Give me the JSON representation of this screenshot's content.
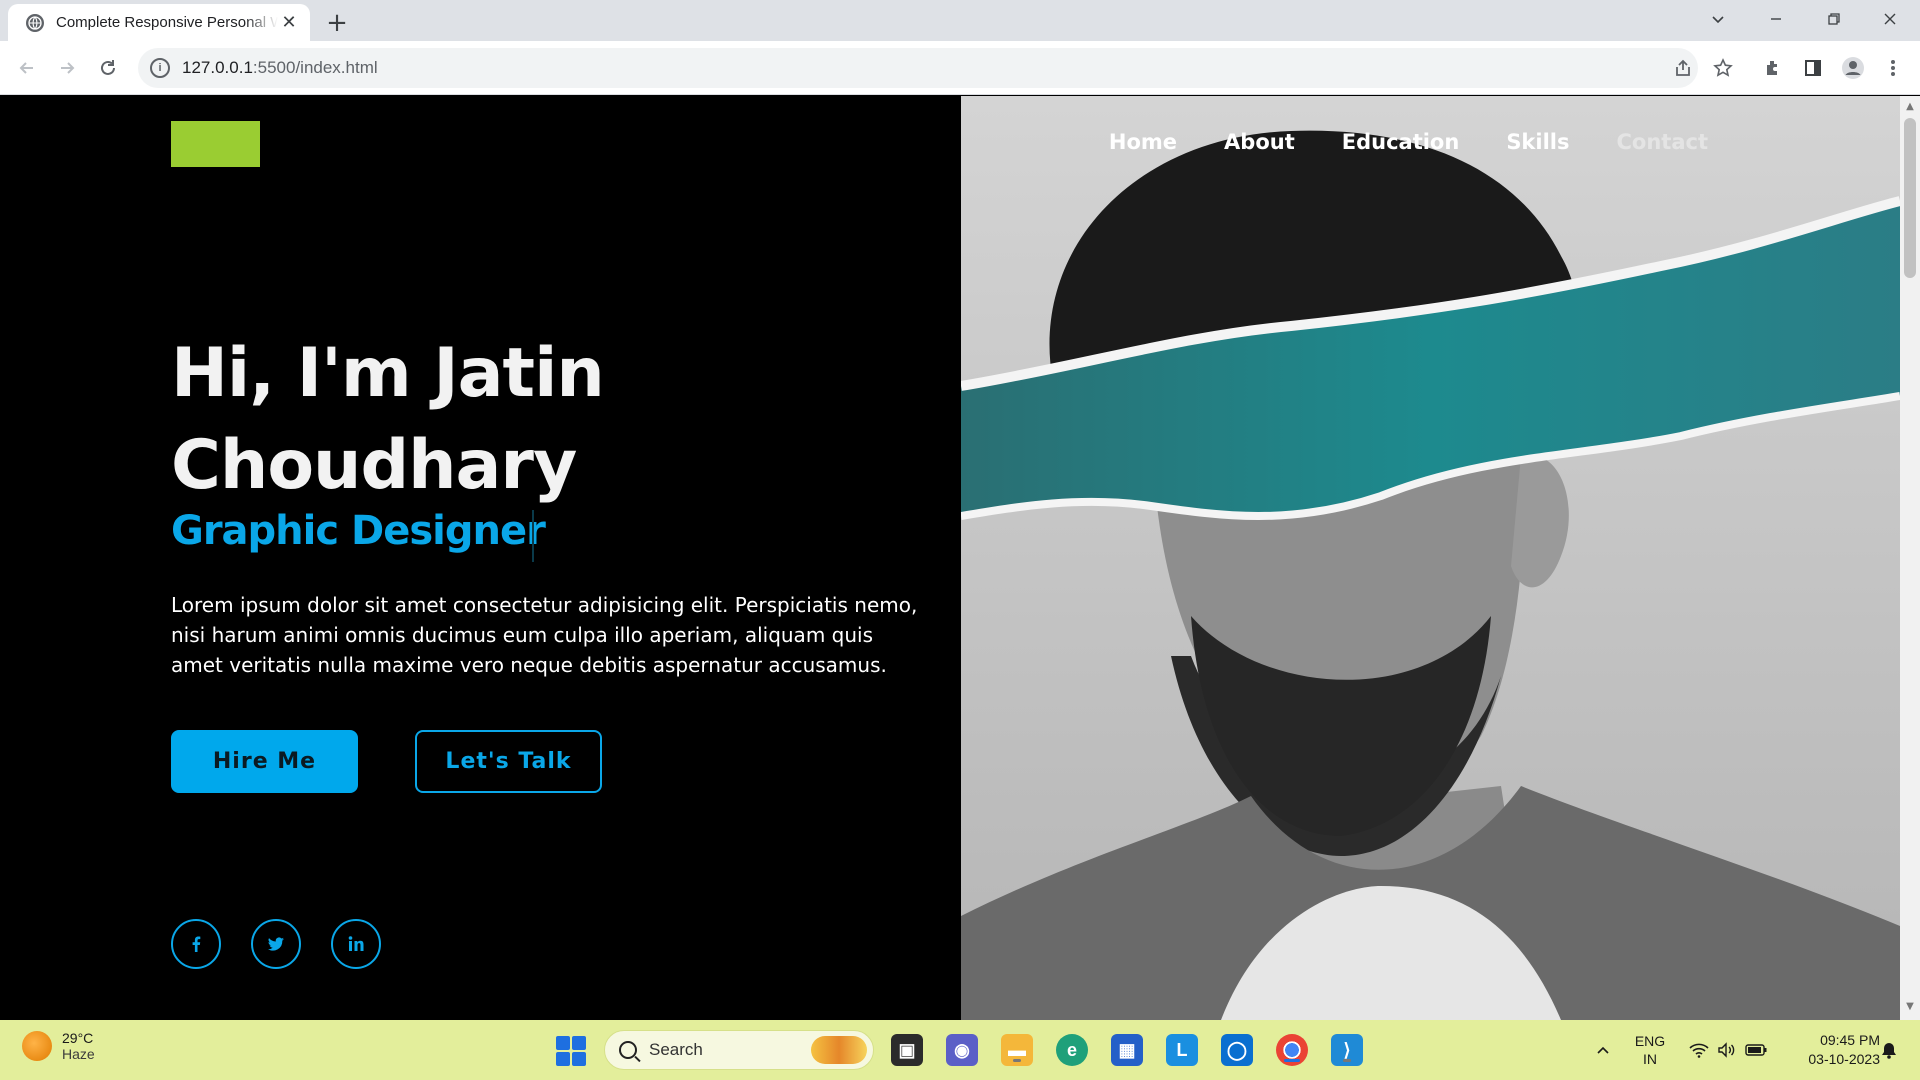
{
  "browser": {
    "tab_title": "Complete Responsive Personal Website",
    "new_tab_symbol": "+",
    "close_symbol": "✕",
    "url_host": "127.0.0.1",
    "url_path": ":5500/index.html"
  },
  "page": {
    "nav": [
      "Home",
      "About",
      "Education",
      "Skills",
      "Contact"
    ],
    "hero": {
      "title_line1": "Hi, I'm Jatin",
      "title_line2": "Choudhary",
      "role": "Graphic Designer",
      "description": "Lorem ipsum dolor sit amet consectetur adipisicing elit. Perspiciatis nemo, nisi harum animi omnis ducimus eum culpa illo aperiam, aliquam quis amet veritatis nulla maxime vero neque debitis aspernatur accusamus.",
      "primary_button": "Hire Me",
      "secondary_button": "Let's Talk"
    },
    "social": {
      "facebook": "f",
      "twitter": "t",
      "linkedin": "in"
    },
    "colors": {
      "logo": "#9acd32",
      "accent": "#00a8ec",
      "background": "#000000"
    }
  },
  "taskbar": {
    "temperature": "29°C",
    "condition": "Haze",
    "search_placeholder": "Search",
    "lang_top": "ENG",
    "lang_bottom": "IN",
    "time": "09:45 PM",
    "date": "03-10-2023",
    "apps": [
      "file-explorer-icon",
      "teams-icon",
      "folder-icon",
      "edge-icon",
      "store-icon",
      "l-app-icon",
      "blue-app-icon",
      "chrome-icon",
      "vscode-icon"
    ]
  }
}
